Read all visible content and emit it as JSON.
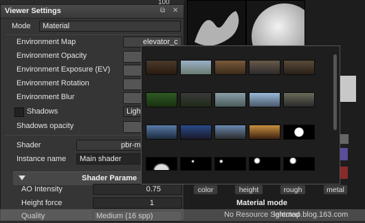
{
  "viewport": {
    "top_value": "100"
  },
  "panel": {
    "title": "Viewer Settings",
    "rows": {
      "mode_label": "Mode",
      "mode_value": "Material",
      "env_map_label": "Environment Map",
      "env_map_value": "elevator_c",
      "env_opacity_label": "Environment Opacity",
      "env_exposure_label": "Environment Exposure (EV)",
      "env_rotation_label": "Environment Rotation",
      "env_blur_label": "Environment Blur",
      "shadows_label": "Shadows",
      "shadows_value": "Ligh",
      "shadows_opacity_label": "Shadows opacity",
      "shader_label": "Shader",
      "shader_value": "pbr-m",
      "instance_label": "Instance name",
      "instance_value": "Main shader",
      "section_title": "Shader Parame",
      "ao_label": "AO Intensity",
      "ao_value": "0.75",
      "height_label": "Height force",
      "height_value": "1",
      "quality_label": "Quality",
      "quality_value": "Medium (16 spp)"
    }
  },
  "channels": {
    "color": "color",
    "height": "height",
    "rough": "rough",
    "metal": "metal"
  },
  "material": {
    "mode_title": "Material mode",
    "no_resource": "No Resource Selected"
  },
  "watermark": "ightmap.blog.163.com",
  "colors": {
    "panel": "#353535",
    "popup": "#1e1e1e",
    "swatch_purple": "#5a4d9a",
    "swatch_red": "#8a2a2a"
  }
}
